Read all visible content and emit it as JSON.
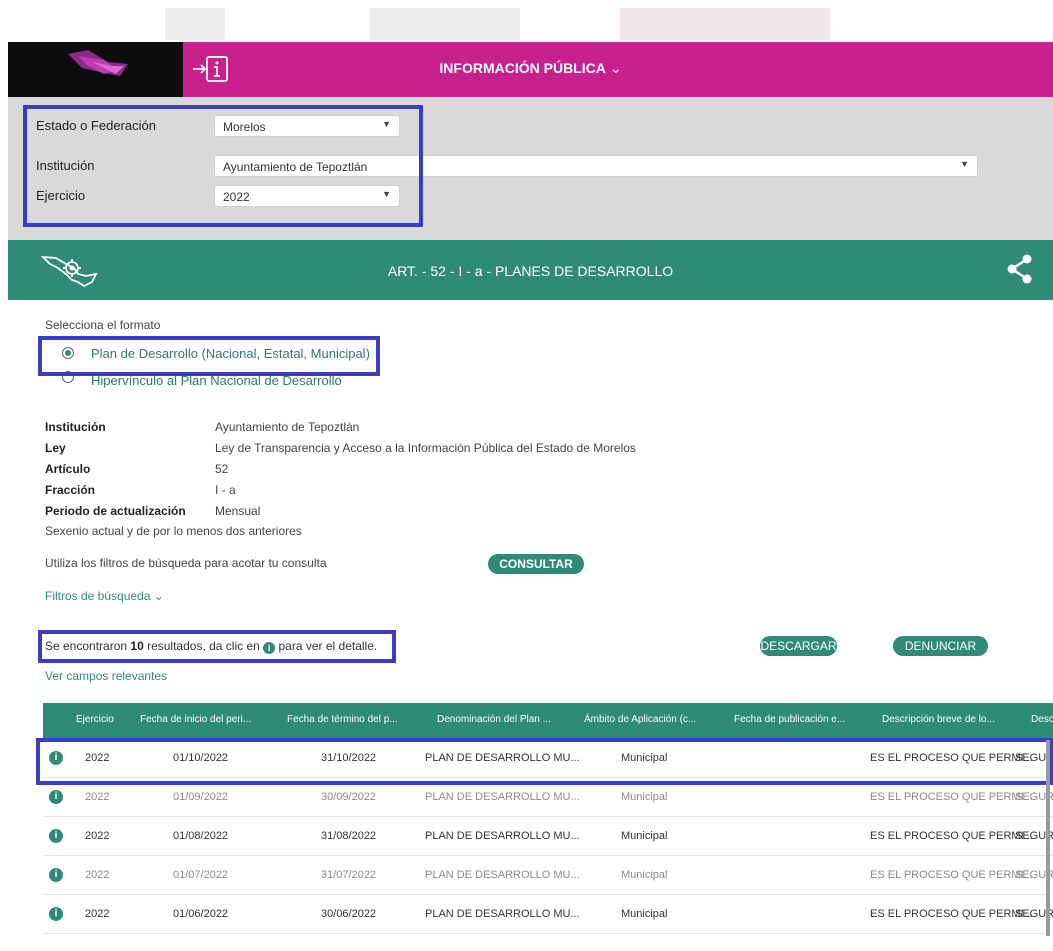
{
  "header": {
    "title": "INFORMACIÓN PÚBLICA",
    "chevron": "⌄",
    "icons": [
      "logo",
      "info-login-icon"
    ],
    "color": "#c8218e"
  },
  "filters": {
    "estado_label": "Estado o Federación",
    "estado_value": "Morelos",
    "institucion_label": "Institución",
    "institucion_value": "Ayuntamiento de Tepoztlán",
    "ejercicio_label": "Ejercicio",
    "ejercicio_value": "2022"
  },
  "band": {
    "title": "ART. - 52 - I - a - PLANES DE DESARROLLO",
    "color": "#2f8a76",
    "icons": [
      "mexico-map-gear-icon",
      "share-icon"
    ]
  },
  "format": {
    "label": "Selecciona el formato",
    "options": [
      {
        "label": "Plan de Desarrollo (Nacional, Estatal, Municipal)",
        "selected": true
      },
      {
        "label": "Hipervínculo al Plan Nacional de Desarrollo",
        "selected": false
      }
    ]
  },
  "details": [
    {
      "key": "Institución",
      "value": "Ayuntamiento de Tepoztlán"
    },
    {
      "key": "Ley",
      "value": "Ley de Transparencia y Acceso a la Información Pública del Estado de Morelos"
    },
    {
      "key": "Artículo",
      "value": "52"
    },
    {
      "key": "Fracción",
      "value": "I - a"
    },
    {
      "key": "Periodo de actualización",
      "value": "Mensual"
    }
  ],
  "period_note": "Sexenio actual y de por lo menos dos anteriores",
  "search": {
    "hint": "Utiliza los filtros de búsqueda para acotar tu consulta",
    "consult_label": "CONSULTAR",
    "filters_link": "Filtros de búsqueda",
    "filters_chevron": "⌄"
  },
  "results": {
    "prefix": "Se encontraron ",
    "count": "10",
    "middle": " resultados, da clic en ",
    "suffix": " para ver el detalle.",
    "download_label": "DESCARGAR",
    "report_label": "DENUNCIAR",
    "relevant_link": "Ver campos relevantes"
  },
  "table": {
    "headers": [
      "Ejercicio",
      "Fecha de inicio del peri...",
      "Fecha de término del p...",
      "Denominación del Plan ...",
      "Ámbito de Aplicación (c...",
      "Fecha de publicación e...",
      "Descripción breve de lo...",
      "Desc"
    ],
    "rows": [
      {
        "ejercicio": "2022",
        "inicio": "01/10/2022",
        "termino": "31/10/2022",
        "plan": "PLAN DE DESARROLLO MU...",
        "ambito": "Municipal",
        "publicacion": "",
        "descripcion": "ES EL PROCESO QUE PERMI...",
        "extra": "SEGUR"
      },
      {
        "ejercicio": "2022",
        "inicio": "01/09/2022",
        "termino": "30/09/2022",
        "plan": "PLAN DE DESARROLLO MU...",
        "ambito": "Municipal",
        "publicacion": "",
        "descripcion": "ES EL PROCESO QUE PERMI...",
        "extra": "SEGUR"
      },
      {
        "ejercicio": "2022",
        "inicio": "01/08/2022",
        "termino": "31/08/2022",
        "plan": "PLAN DE DESARROLLO MU...",
        "ambito": "Municipal",
        "publicacion": "",
        "descripcion": "ES EL PROCESO QUE PERMI...",
        "extra": "SEGUR"
      },
      {
        "ejercicio": "2022",
        "inicio": "01/07/2022",
        "termino": "31/07/2022",
        "plan": "PLAN DE DESARROLLO MU...",
        "ambito": "Municipal",
        "publicacion": "",
        "descripcion": "ES EL PROCESO QUE PERMI...",
        "extra": "SEGUR"
      },
      {
        "ejercicio": "2022",
        "inicio": "01/06/2022",
        "termino": "30/06/2022",
        "plan": "PLAN DE DESARROLLO MU...",
        "ambito": "Municipal",
        "publicacion": "",
        "descripcion": "ES EL PROCESO QUE PERMI...",
        "extra": "SEGUR"
      }
    ]
  },
  "highlight_color": "#3b3bc8"
}
